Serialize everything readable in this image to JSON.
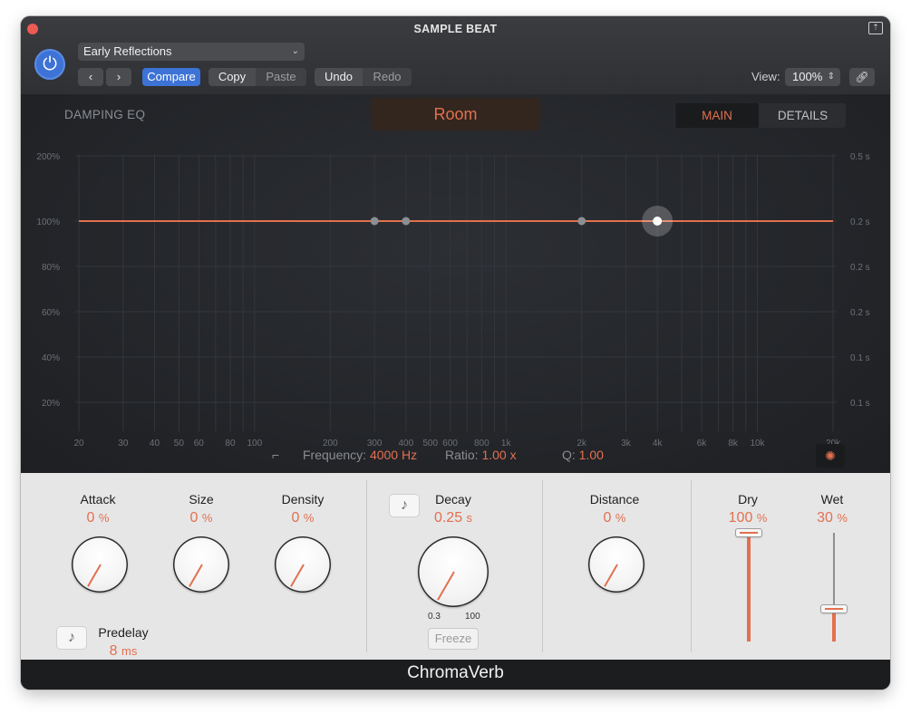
{
  "window": {
    "title": "SAMPLE BEAT"
  },
  "header": {
    "preset": "Early Reflections",
    "compare_label": "Compare",
    "copy_label": "Copy",
    "paste_label": "Paste",
    "undo_label": "Undo",
    "redo_label": "Redo",
    "view_label": "View:",
    "view_value": "100%"
  },
  "display": {
    "section_label": "DAMPING EQ",
    "room_type": "Room",
    "tabs": {
      "main": "MAIN",
      "details": "DETAILS"
    },
    "eq": {
      "y_labels_left": [
        "200%",
        "100%",
        "80%",
        "60%",
        "40%",
        "20%"
      ],
      "y_labels_right": [
        "0.5 s",
        "0.2 s",
        "0.2 s",
        "0.2 s",
        "0.1 s",
        "0.1 s"
      ],
      "x_labels": [
        "20",
        "30",
        "40",
        "50",
        "60",
        "80",
        "100",
        "200",
        "300",
        "400",
        "500",
        "600",
        "800",
        "1k",
        "2k",
        "3k",
        "4k",
        "6k",
        "8k",
        "10k",
        "20k"
      ],
      "nodes_hz": [
        300,
        400,
        2000,
        4000
      ],
      "selected_node_hz": 4000,
      "level_percent": 100
    },
    "params": {
      "frequency_label": "Frequency:",
      "frequency_value": "4000 Hz",
      "ratio_label": "Ratio:",
      "ratio_value": "1.00 x",
      "q_label": "Q:",
      "q_value": "1.00"
    },
    "accent_color": "#e2704f"
  },
  "controls": {
    "attack": {
      "label": "Attack",
      "value": "0",
      "unit": "%"
    },
    "size": {
      "label": "Size",
      "value": "0",
      "unit": "%"
    },
    "density": {
      "label": "Density",
      "value": "0",
      "unit": "%"
    },
    "predelay": {
      "label": "Predelay",
      "value": "8",
      "unit": "ms"
    },
    "decay": {
      "label": "Decay",
      "value": "0.25",
      "unit": "s",
      "min_label": "0.3",
      "max_label": "100"
    },
    "freeze_label": "Freeze",
    "distance": {
      "label": "Distance",
      "value": "0",
      "unit": "%"
    },
    "dry": {
      "label": "Dry",
      "value": "100",
      "unit": "%",
      "level_fraction": 1.0
    },
    "wet": {
      "label": "Wet",
      "value": "30",
      "unit": "%",
      "level_fraction": 0.3
    }
  },
  "footer": {
    "product_name": "ChromaVerb"
  }
}
